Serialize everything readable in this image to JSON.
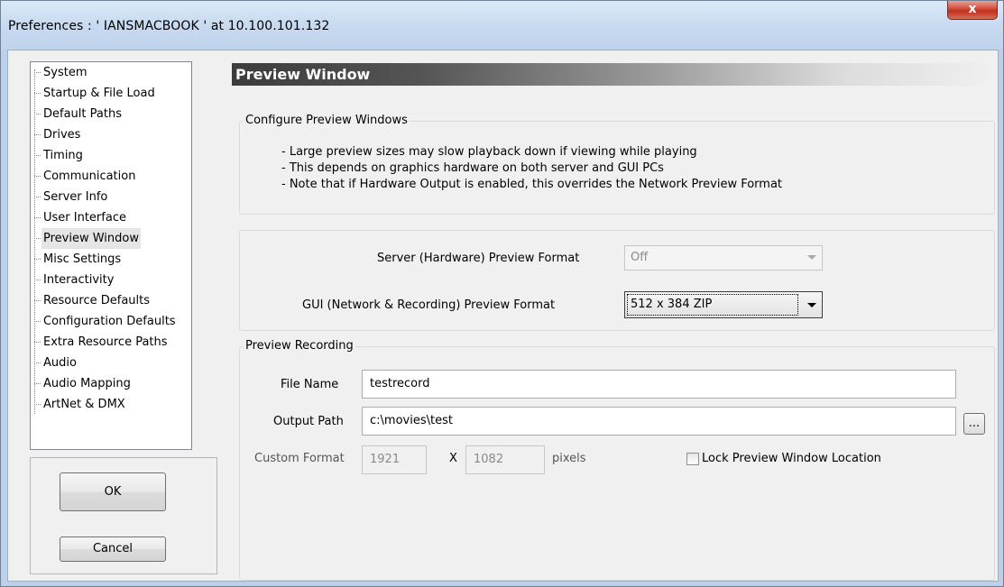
{
  "window": {
    "title": "Preferences  :  ' IANSMACBOOK '  at  10.100.101.132",
    "close_label": "x"
  },
  "sidebar": {
    "items": [
      {
        "label": "System"
      },
      {
        "label": "Startup & File Load"
      },
      {
        "label": "Default Paths"
      },
      {
        "label": "Drives"
      },
      {
        "label": "Timing"
      },
      {
        "label": "Communication"
      },
      {
        "label": "Server Info"
      },
      {
        "label": "User Interface"
      },
      {
        "label": "Preview Window",
        "selected": true
      },
      {
        "label": "Misc Settings"
      },
      {
        "label": "Interactivity"
      },
      {
        "label": "Resource Defaults"
      },
      {
        "label": "Configuration Defaults"
      },
      {
        "label": "Extra Resource Paths"
      },
      {
        "label": "Audio"
      },
      {
        "label": "Audio Mapping"
      },
      {
        "label": "ArtNet & DMX"
      }
    ]
  },
  "buttons": {
    "ok": "OK",
    "cancel": "Cancel"
  },
  "main": {
    "header": "Preview Window",
    "configure": {
      "title": "Configure Preview Windows",
      "notes": [
        "- Large preview sizes may slow playback down if viewing while playing",
        "- This depends on graphics hardware on both server and GUI PCs",
        "- Note that if Hardware Output is enabled, this overrides the Network Preview Format"
      ]
    },
    "formats": {
      "server_label": "Server (Hardware) Preview Format",
      "server_value": "Off",
      "gui_label": "GUI (Network & Recording) Preview Format",
      "gui_value": "512 x 384 ZIP"
    },
    "recording": {
      "title": "Preview Recording",
      "file_name_label": "File Name",
      "file_name_value": "testrecord",
      "output_path_label": "Output Path",
      "output_path_value": "c:\\movies\\test",
      "browse_label": "...",
      "custom_format_label": "Custom Format",
      "width_value": "1921",
      "x_label": "X",
      "height_value": "1082",
      "pixels_label": "pixels",
      "lock_label": "Lock Preview Window Location",
      "lock_checked": false
    }
  },
  "colors": {
    "header_dark": "#3c3c3c",
    "close_red": "#c0301f",
    "title_blue": "#c5d8ef"
  }
}
